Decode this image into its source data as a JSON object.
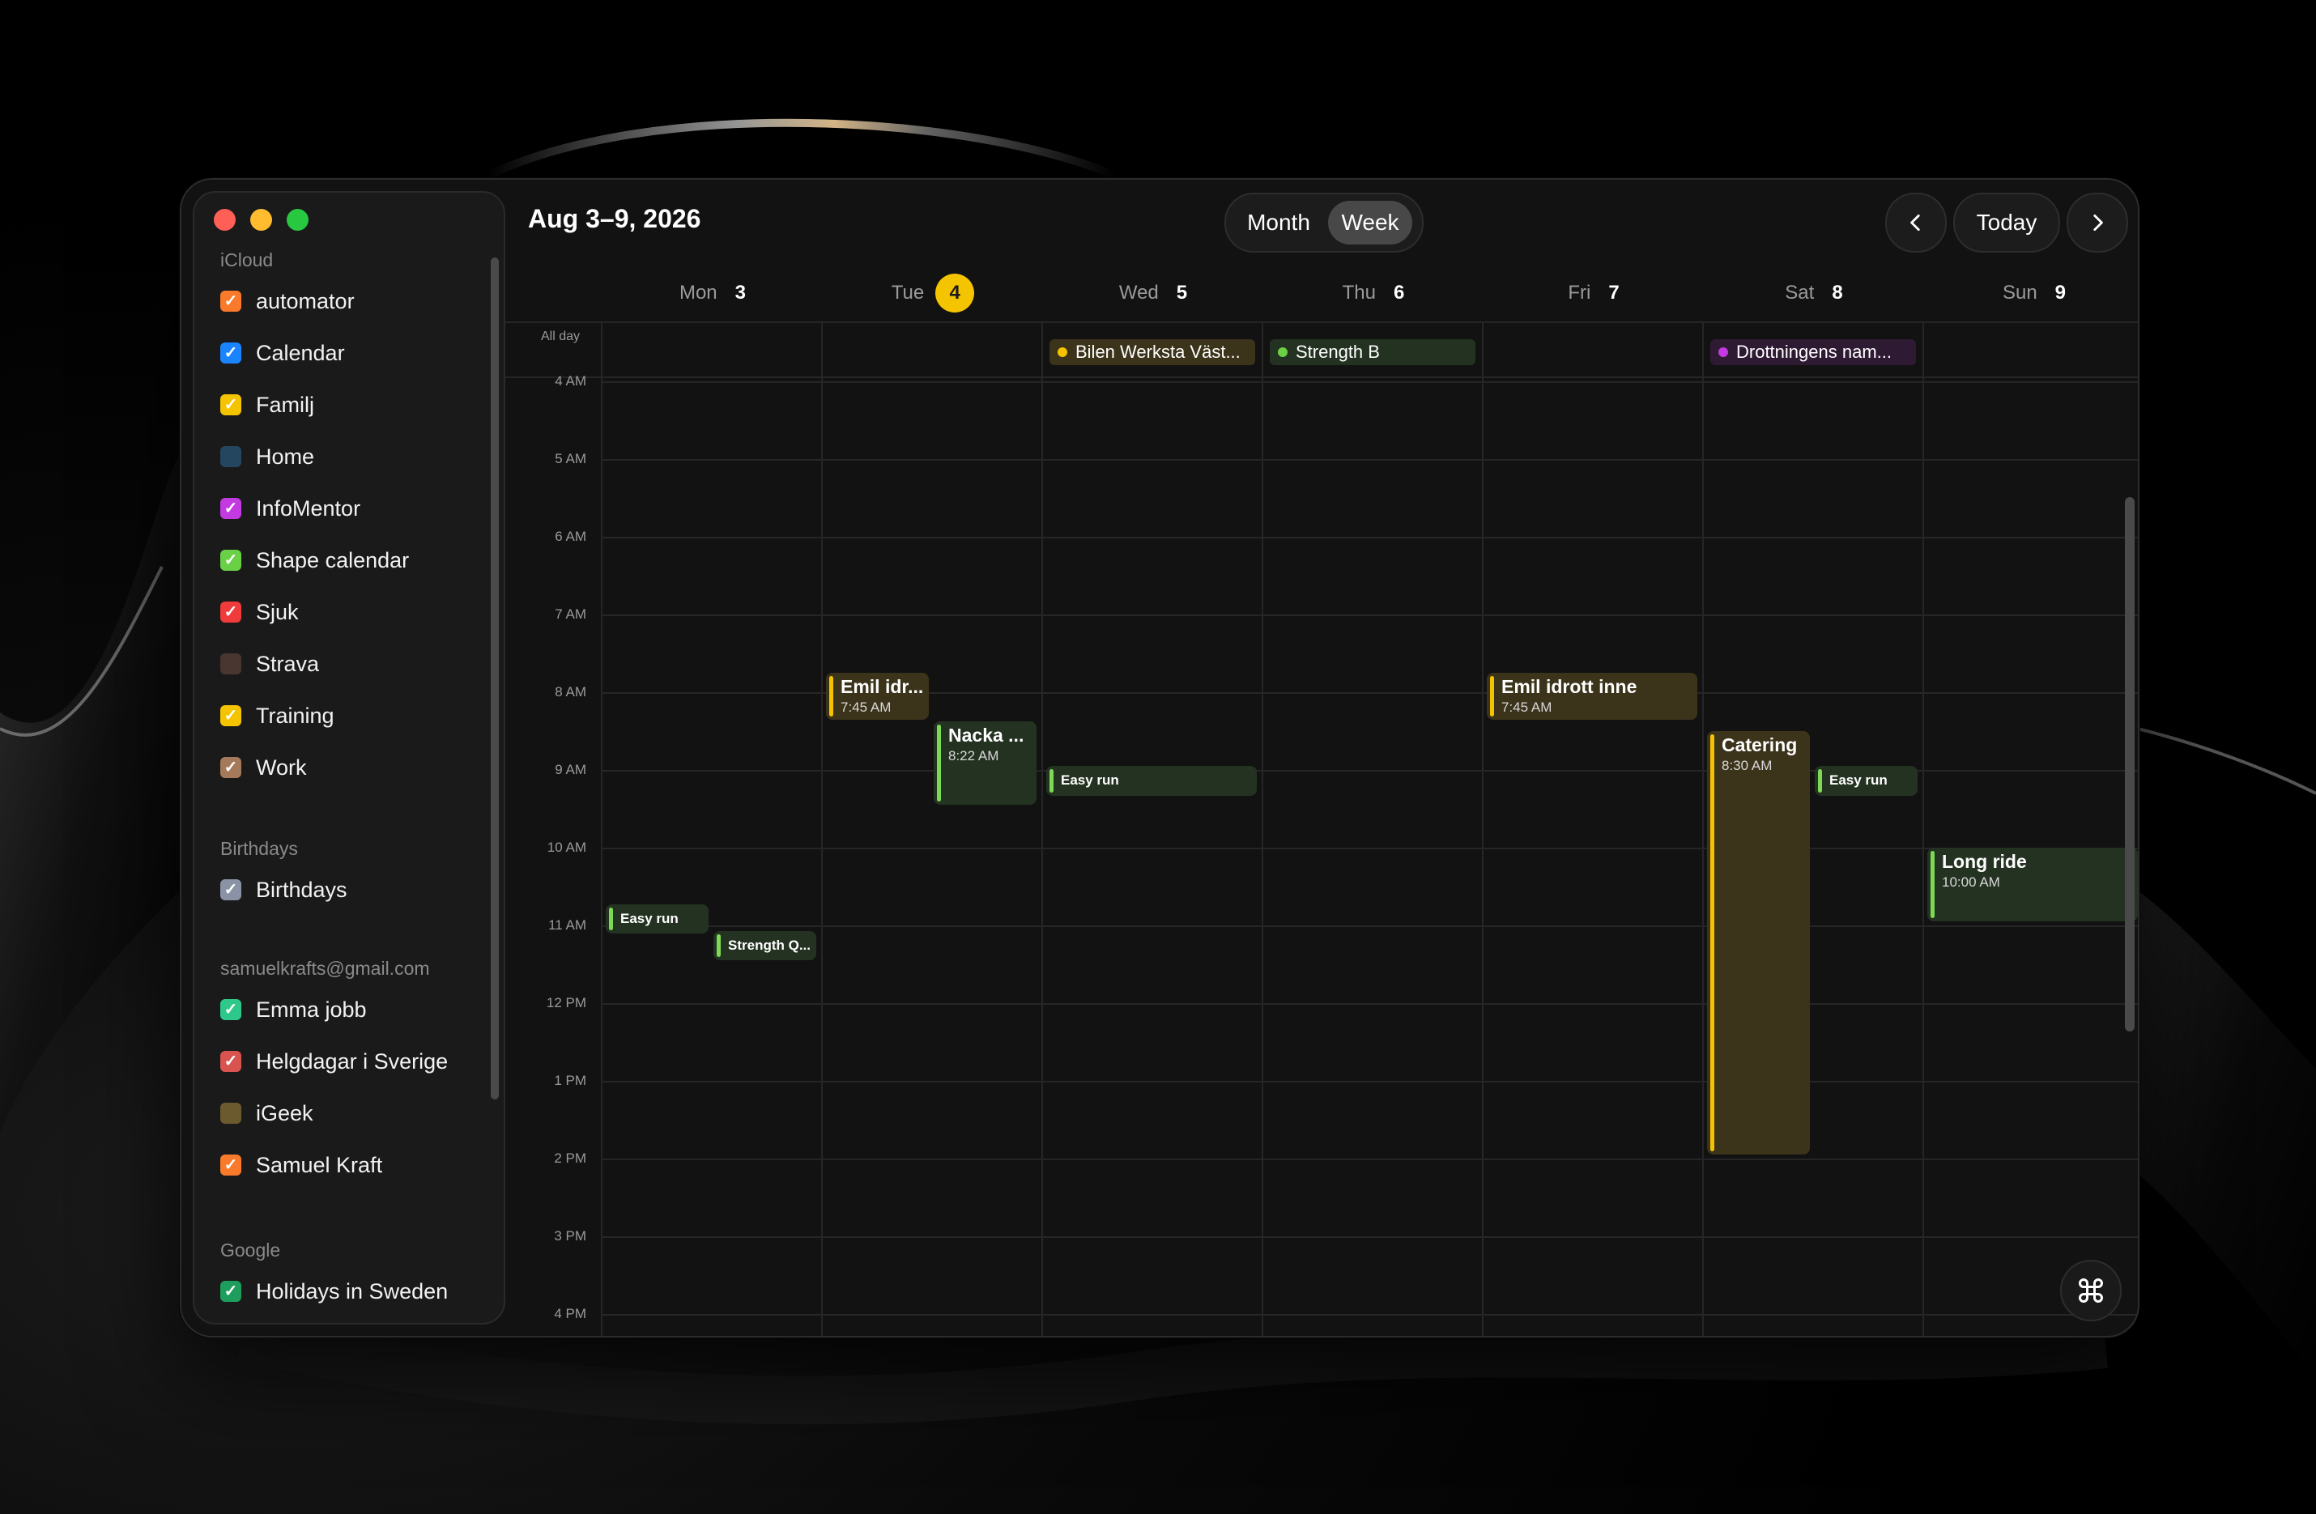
{
  "window": {
    "title": "Aug 3–9, 2026",
    "view_toggle": {
      "month_label": "Month",
      "week_label": "Week",
      "selected": "Week"
    },
    "today_label": "Today"
  },
  "sidebar": {
    "groups": [
      {
        "title": "iCloud",
        "items": [
          {
            "label": "automator",
            "color": "#f97a2b",
            "checked": true
          },
          {
            "label": "Calendar",
            "color": "#1a84ff",
            "checked": true
          },
          {
            "label": "Familj",
            "color": "#f5c400",
            "checked": true
          },
          {
            "label": "Home",
            "color": "#24465e",
            "checked": false
          },
          {
            "label": "InfoMentor",
            "color": "#c23ae0",
            "checked": true
          },
          {
            "label": "Shape calendar",
            "color": "#6ad045",
            "checked": true
          },
          {
            "label": "Sjuk",
            "color": "#ef3b3b",
            "checked": true
          },
          {
            "label": "Strava",
            "color": "#4a3630",
            "checked": false
          },
          {
            "label": "Training",
            "color": "#f5c400",
            "checked": true
          },
          {
            "label": "Work",
            "color": "#a57a5a",
            "checked": true
          }
        ]
      },
      {
        "title": "Birthdays",
        "items": [
          {
            "label": "Birthdays",
            "color": "#8a93a6",
            "checked": true
          }
        ]
      },
      {
        "title": "samuelkrafts@gmail.com",
        "items": [
          {
            "label": "Emma jobb",
            "color": "#2ec98a",
            "checked": true
          },
          {
            "label": "Helgdagar i Sverige",
            "color": "#d9534f",
            "checked": true
          },
          {
            "label": "iGeek",
            "color": "#6b5a2e",
            "checked": false
          },
          {
            "label": "Samuel Kraft",
            "color": "#f97a2b",
            "checked": true
          }
        ]
      },
      {
        "title": "Google",
        "items": [
          {
            "label": "Holidays in Sweden",
            "color": "#1e9e5c",
            "checked": true
          }
        ]
      }
    ]
  },
  "days": [
    {
      "name": "Mon",
      "num": "3",
      "today": false
    },
    {
      "name": "Tue",
      "num": "4",
      "today": true
    },
    {
      "name": "Wed",
      "num": "5",
      "today": false
    },
    {
      "name": "Thu",
      "num": "6",
      "today": false
    },
    {
      "name": "Fri",
      "num": "7",
      "today": false
    },
    {
      "name": "Sat",
      "num": "8",
      "today": false
    },
    {
      "name": "Sun",
      "num": "9",
      "today": false
    }
  ],
  "allday_label": "All day",
  "hours": [
    "4 AM",
    "5 AM",
    "6 AM",
    "7 AM",
    "8 AM",
    "9 AM",
    "10 AM",
    "11 AM",
    "12 PM",
    "1 PM",
    "2 PM",
    "3 PM",
    "4 PM"
  ],
  "allday_events": [
    {
      "day": 2,
      "title": "Bilen Werksta Väst...",
      "color": "#f5c400",
      "bg": "#3b331a"
    },
    {
      "day": 3,
      "title": "Strength B",
      "color": "#6ad045",
      "bg": "#243321"
    },
    {
      "day": 5,
      "title": "Drottningens nam...",
      "color": "#c23ae0",
      "bg": "#2e1a33"
    }
  ],
  "events": [
    {
      "day": 0,
      "col": 0,
      "cols": 2,
      "start": 10.73,
      "end": 11.1,
      "title": "Easy run",
      "time": "",
      "style": "green",
      "small": true
    },
    {
      "day": 0,
      "col": 1,
      "cols": 2,
      "start": 11.07,
      "end": 11.45,
      "title": "Strength Q...",
      "time": "",
      "style": "green",
      "small": true
    },
    {
      "day": 1,
      "col": 0,
      "cols": 2,
      "start": 7.75,
      "end": 8.35,
      "title": "Emil idr...",
      "time": "7:45 AM",
      "style": "yellow",
      "small": false
    },
    {
      "day": 1,
      "col": 1,
      "cols": 2,
      "start": 8.37,
      "end": 9.45,
      "title": "Nacka ...",
      "time": "8:22 AM",
      "style": "green",
      "small": false
    },
    {
      "day": 2,
      "col": 0,
      "cols": 1,
      "start": 8.95,
      "end": 9.33,
      "title": "Easy run",
      "time": "",
      "style": "green",
      "small": true
    },
    {
      "day": 4,
      "col": 0,
      "cols": 1,
      "start": 7.75,
      "end": 8.35,
      "title": "Emil idrott inne",
      "time": "7:45 AM",
      "style": "yellow",
      "small": false
    },
    {
      "day": 5,
      "col": 0,
      "cols": 2,
      "start": 8.5,
      "end": 13.95,
      "title": "Catering",
      "time": "8:30 AM",
      "style": "yellow",
      "small": false
    },
    {
      "day": 5,
      "col": 1,
      "cols": 2,
      "start": 8.95,
      "end": 9.33,
      "title": "Easy run",
      "time": "",
      "style": "green",
      "small": true
    },
    {
      "day": 6,
      "col": 0,
      "cols": 1,
      "start": 10.0,
      "end": 10.95,
      "title": "Long ride",
      "time": "10:00 AM",
      "style": "green",
      "small": false
    }
  ]
}
